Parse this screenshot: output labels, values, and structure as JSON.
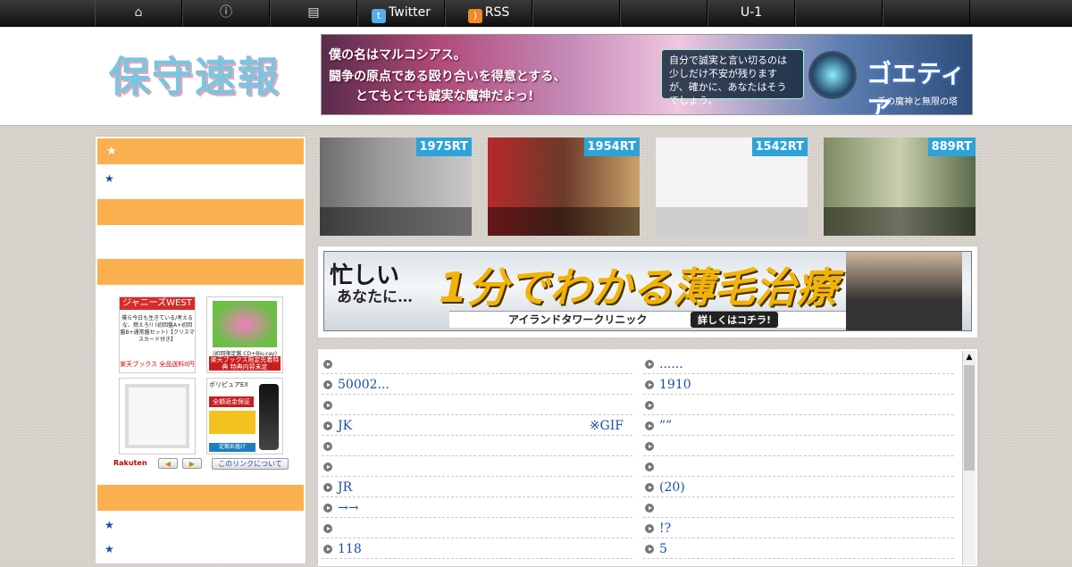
{
  "nav": {
    "items": [
      {
        "icon": "home-icon",
        "label": ""
      },
      {
        "icon": "info-icon",
        "label": ""
      },
      {
        "icon": "archive-icon",
        "label": ""
      },
      {
        "icon": "twitter-icon",
        "label": "Twitter"
      },
      {
        "icon": "rss-icon",
        "label": "RSS"
      },
      {
        "icon": "",
        "label": ""
      },
      {
        "icon": "",
        "label": ""
      },
      {
        "icon": "",
        "label": "U-1"
      },
      {
        "icon": "",
        "label": ""
      },
      {
        "icon": "",
        "label": ""
      },
      {
        "icon": "",
        "label": ""
      }
    ]
  },
  "header": {
    "logo": "保守速報",
    "banner": {
      "line1": "僕の名はマルコシアス。",
      "line2": "闘争の原点である殴り合いを得意とする、",
      "line3": "とてもとても誠実な魔神だよっ!",
      "box": "自分で誠実と言い切るのは少しだけ不安が残りますが、確かに、あなたはそうでしょう。",
      "brand": "ゴエティア",
      "sub": "千の魔神と無限の塔"
    }
  },
  "sidebar": {
    "bars": [
      "★",
      "",
      "",
      ""
    ],
    "links_top": [
      "★"
    ],
    "links_bottom": [
      "★",
      "★"
    ],
    "shop": {
      "item1": {
        "head": "ジャニーズWEST",
        "body": "僕ら今日も生きている/考えるな、燃えろ!! (初回盤A+初回盤B+通常盤セット)【クリスマスカード付き】",
        "foot": "楽天ブックス 全品送料0円"
      },
      "item2": {
        "label": "(初回限定盤 CD+Blu-ray)",
        "red": "楽天ブックス限定先着特典 特典内容未定"
      },
      "item4": {
        "head": "ポリピュアEX",
        "gold": "全額返金保証",
        "foot": "定期お届け"
      },
      "rakuten": "Rakuten",
      "prev": "◀",
      "next": "▶",
      "about": "このリンクについて"
    }
  },
  "thumbs": [
    {
      "rt": "1975RT",
      "bg": "#8a8a8a"
    },
    {
      "rt": "1954RT",
      "bg": "#6b3a2a"
    },
    {
      "rt": "1542RT",
      "bg": "#f2f2f2"
    },
    {
      "rt": "889RT",
      "bg": "#9aa27a"
    }
  ],
  "ad": {
    "busy": "忙しい",
    "anata": "あなたに…",
    "headline": "1分でわかる薄毛治療",
    "clinic": "アイランドタワークリニック",
    "cta": "詳しくはコチラ!"
  },
  "list": {
    "left": [
      "",
      "50002...",
      "",
      "JK",
      "",
      "",
      "JR",
      "→→",
      "",
      " 118"
    ],
    "left_right": [
      "",
      "",
      "",
      "※GIF",
      "",
      "",
      "",
      "",
      "",
      ""
    ],
    "right": [
      "......",
      "1910",
      "",
      "”” ",
      "",
      "",
      "(20)",
      "",
      "!?",
      "5"
    ]
  }
}
